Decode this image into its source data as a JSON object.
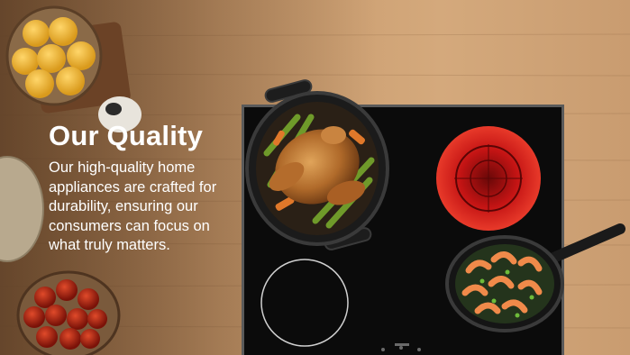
{
  "hero": {
    "title": "Our Quality",
    "description": "Our high-quality home appliances are crafted for durability, ensuring our consumers can focus on what truly matters.",
    "image_alt": "Black ceramic cooktop with roast chicken in a pot and shrimp in a pan on a wooden counter"
  },
  "colors": {
    "text": "#ffffff",
    "cooktop": "#0b0b0b",
    "burner_hot": "#d92020",
    "wood": "#c79a6b"
  }
}
